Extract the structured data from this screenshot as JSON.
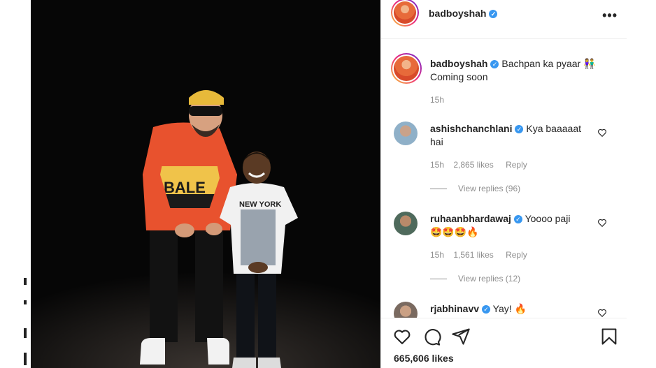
{
  "post": {
    "username": "badboyshah",
    "verified_glyph": "✓",
    "more_icon": "•••",
    "caption_line1": "Bachpan ka pyaar 👫",
    "caption_line2": "Coming soon",
    "time": "15h",
    "likes": "665,606 likes"
  },
  "comments": [
    {
      "username": "ashishchanchlani",
      "text": "Kya baaaaat",
      "text2": "hai",
      "time": "15h",
      "likes": "2,865 likes",
      "reply": "Reply",
      "view_replies": "View replies (96)"
    },
    {
      "username": "ruhaanbhardawaj",
      "text": "Yoooo paji",
      "text2": "🤩🤩🤩🔥",
      "time": "15h",
      "likes": "1,561 likes",
      "reply": "Reply",
      "view_replies": "View replies (12)"
    },
    {
      "username": "rjabhinavv",
      "text": "Yay! 🔥"
    }
  ],
  "icons": {
    "like": "heart-icon",
    "comment": "comment-icon",
    "share": "send-icon",
    "save": "bookmark-icon"
  },
  "colors": {
    "verified": "#3897f0",
    "secondary_text": "#8e8e8e",
    "photo_background": "#060606"
  }
}
